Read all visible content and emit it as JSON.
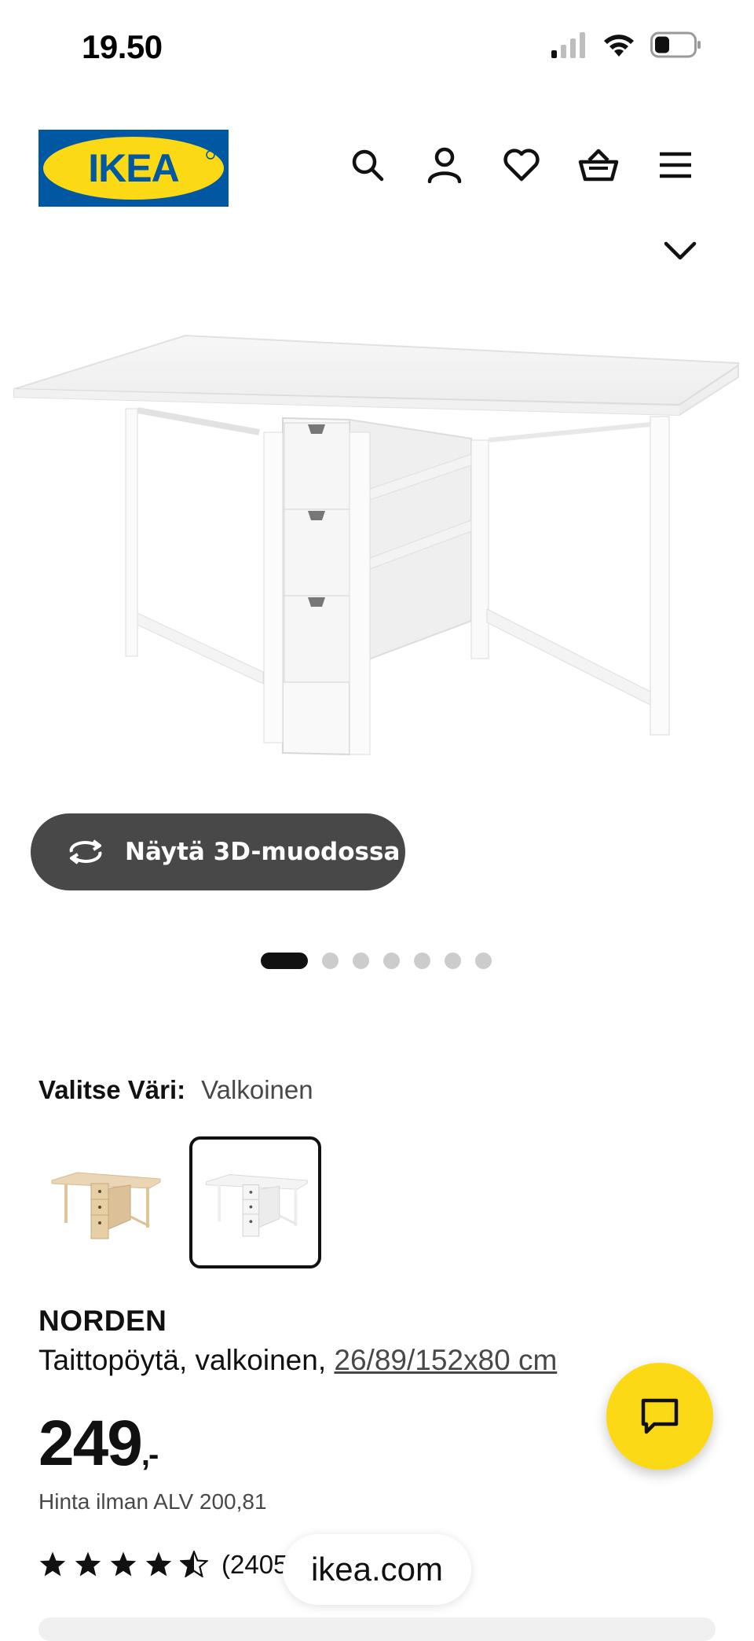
{
  "status_bar": {
    "time": "19.50"
  },
  "header": {
    "brand": "IKEA",
    "icons": [
      "search-icon",
      "account-icon",
      "heart-icon",
      "basket-icon",
      "menu-icon"
    ]
  },
  "gallery": {
    "view_3d_label": "Näytä 3D-muodossa",
    "image_count": 7,
    "active_index": 0
  },
  "color_select": {
    "label": "Valitse Väri:",
    "selected": "Valkoinen"
  },
  "product": {
    "name": "NORDEN",
    "description": "Taittopöytä, valkoinen, ",
    "dimensions": "26/89/152x80 cm",
    "price_main": "249",
    "price_suffix": ",-",
    "price_without_vat": "Hinta ilman ALV 200,81",
    "rating_stars": 4.5,
    "rating_count": "(2405"
  },
  "browser": {
    "url": "ikea.com"
  },
  "colors": {
    "ikea_blue": "#0058A3",
    "ikea_yellow": "#FBD914",
    "dark_button": "#484848"
  }
}
